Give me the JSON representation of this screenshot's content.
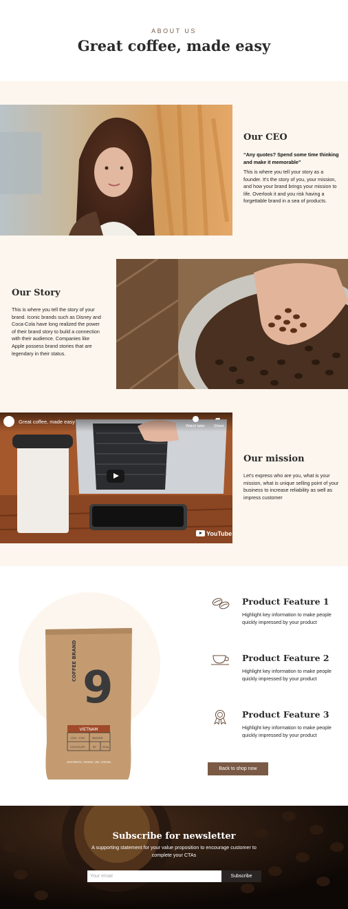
{
  "colors": {
    "cream": "#fdf6ee",
    "accent_brown": "#7a5a45",
    "dark": "#2b2b2b"
  },
  "header": {
    "eyebrow": "ABOUT US",
    "title": "Great coffee, made easy"
  },
  "ceo": {
    "heading": "Our CEO",
    "quote": "“Any quotes? Spend some time thinking and make it memorable”",
    "body": "This is where you tell your story as a founder. It's the story of you, your mission, and how your brand brings your mission to life. Overlook it and you risk having a forgettable brand in a sea of products."
  },
  "story": {
    "heading": "Our Story",
    "body": "This is where you tell the story of your brand. Iconic brands such as Disney and Coca-Cola have long realized the power of their brand story to build a connection with their audience. Companies like Apple possess brand stories that are legendary in their status."
  },
  "video": {
    "title": "Great coffee, made easy",
    "watch_later": "Watch later",
    "share": "Share",
    "platform": "YouTube"
  },
  "mission": {
    "heading": "Our mission",
    "body": "Let's express who are you, what is your mission, what is unique selling point of your business to increase reliability as well as impress customer"
  },
  "bag": {
    "number": "9",
    "brand": "COFFEE BRAND",
    "origin": "VIETNAM",
    "cell_1": "1100 - 1300",
    "cell_2": "WASHED",
    "cell_3": "CHOCOLATE",
    "cell_4": "80",
    "cell_5": "500g",
    "footer": "AEROPRESS, CHEMEX, V60, SYPHON"
  },
  "features": [
    {
      "title": "Product Feature 1",
      "body": "Highlight key information to make people quickly impressed by your product",
      "icon": "coffee-beans-icon"
    },
    {
      "title": "Product Feature 2",
      "body": "Highlight key information to make people quickly impressed by your product",
      "icon": "coffee-cup-icon"
    },
    {
      "title": "Product Feature 3",
      "body": "Highlight key information to make people quickly impressed by your product",
      "icon": "award-ribbon-icon"
    }
  ],
  "shop_button": "Back to shop now",
  "newsletter": {
    "heading": "Subscribe for newsletter",
    "body": "A supporting statement for your value proposition to encourage customer to complete your CTAs",
    "email_placeholder": "Your email",
    "button": "Subscribe"
  }
}
